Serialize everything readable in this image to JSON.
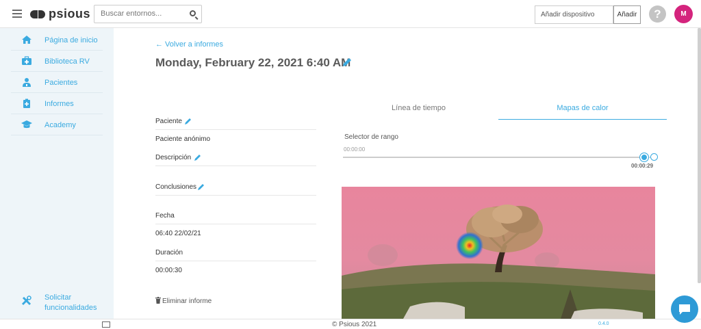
{
  "header": {
    "logo_text": "psious",
    "search_placeholder": "Buscar entornos...",
    "device_placeholder": "Añadir dispositivo",
    "device_button": "Añadir",
    "help_symbol": "?",
    "avatar_initial": "M",
    "avatar_color": "#d4247d"
  },
  "sidebar": {
    "items": [
      {
        "label": "Página de inicio",
        "icon": "home-icon"
      },
      {
        "label": "Biblioteca RV",
        "icon": "medkit-icon"
      },
      {
        "label": "Pacientes",
        "icon": "user-md-icon"
      },
      {
        "label": "Informes",
        "icon": "clipboard-plus-icon"
      },
      {
        "label": "Academy",
        "icon": "graduation-cap-icon"
      }
    ],
    "bottom": {
      "line1": "Solicitar",
      "line2": "funcionalidades",
      "icon": "tools-icon"
    }
  },
  "report": {
    "back_link": "← Volver a informes",
    "title": "Monday, February 22, 2021 6:40 AM",
    "fields": {
      "patient_label": "Paciente",
      "patient_value": "Paciente anónimo",
      "description_label": "Descripción",
      "conclusions_label": "Conclusiones",
      "date_label": "Fecha",
      "date_value": "06:40 22/02/21",
      "duration_label": "Duración",
      "duration_value": "00:00:30"
    },
    "delete_label": "Eliminar informe"
  },
  "tabs": {
    "timeline": "Línea de tiempo",
    "heatmaps": "Mapas de calor",
    "active": "heatmaps"
  },
  "range": {
    "label": "Selector de rango",
    "start": "00:00:00",
    "end": "00:00:29",
    "position_fraction": 0.967
  },
  "footer": {
    "copyright": "© Psious 2021",
    "version": "0.4.0"
  },
  "colors": {
    "accent": "#3aaae0",
    "sidebar_bg": "#eef5f9",
    "heatmap_overlay": "#e8859d"
  }
}
